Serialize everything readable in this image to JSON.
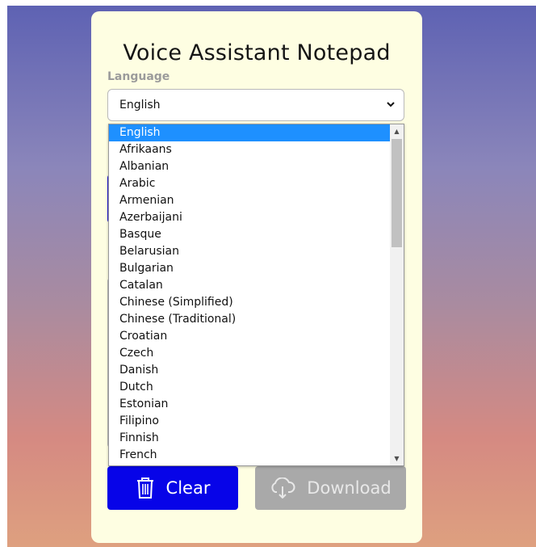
{
  "app": {
    "title": "Voice Assistant Notepad"
  },
  "language": {
    "label": "Language",
    "selected": "English",
    "options": [
      "English",
      "Afrikaans",
      "Albanian",
      "Arabic",
      "Armenian",
      "Azerbaijani",
      "Basque",
      "Belarusian",
      "Bulgarian",
      "Catalan",
      "Chinese (Simplified)",
      "Chinese (Traditional)",
      "Croatian",
      "Czech",
      "Danish",
      "Dutch",
      "Estonian",
      "Filipino",
      "Finnish",
      "French"
    ]
  },
  "buttons": {
    "clear": "Clear",
    "download": "Download"
  },
  "colors": {
    "card_bg": "#fefee2",
    "clear_button": "#0704e8",
    "download_button": "#a9a9a9",
    "selected_option": "#1e90ff"
  },
  "icons": {
    "clear": "trash-icon",
    "download": "cloud-download-icon",
    "select": "chevron-down-icon"
  }
}
